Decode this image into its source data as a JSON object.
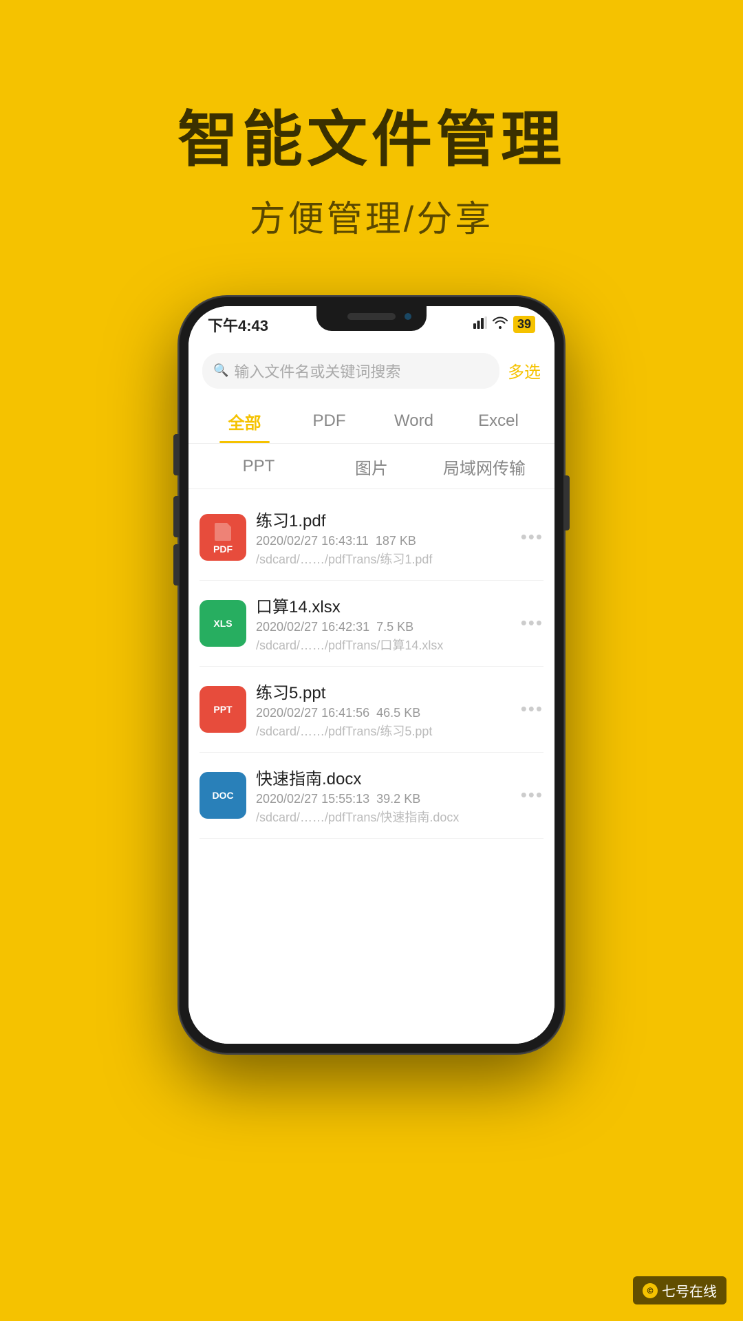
{
  "hero": {
    "title": "智能文件管理",
    "subtitle": "方便管理/分享"
  },
  "status_bar": {
    "time": "下午4:43",
    "signal": "📶",
    "wifi": "WiFi",
    "battery": "39"
  },
  "search": {
    "placeholder": "输入文件名或关键词搜索",
    "multiselect": "多选"
  },
  "tabs_row1": [
    {
      "id": "all",
      "label": "全部",
      "active": true
    },
    {
      "id": "pdf",
      "label": "PDF",
      "active": false
    },
    {
      "id": "word",
      "label": "Word",
      "active": false
    },
    {
      "id": "excel",
      "label": "Excel",
      "active": false
    }
  ],
  "tabs_row2": [
    {
      "id": "ppt",
      "label": "PPT",
      "active": false
    },
    {
      "id": "image",
      "label": "图片",
      "active": false
    },
    {
      "id": "lan",
      "label": "局域网传输",
      "active": false
    }
  ],
  "files": [
    {
      "name": "练习1.pdf",
      "type": "pdf",
      "type_label": "PDF",
      "date": "2020/02/27 16:43:11",
      "size": "187 KB",
      "path": "/sdcard/……/pdfTrans/练习1.pdf"
    },
    {
      "name": "口算14.xlsx",
      "type": "xlsx",
      "type_label": "XLS",
      "date": "2020/02/27 16:42:31",
      "size": "7.5 KB",
      "path": "/sdcard/……/pdfTrans/口算14.xlsx"
    },
    {
      "name": "练习5.ppt",
      "type": "ppt",
      "type_label": "PPT",
      "date": "2020/02/27 16:41:56",
      "size": "46.5 KB",
      "path": "/sdcard/……/pdfTrans/练习5.ppt"
    },
    {
      "name": "快速指南.docx",
      "type": "docx",
      "type_label": "DOC",
      "date": "2020/02/27 15:55:13",
      "size": "39.2 KB",
      "path": "/sdcard/……/pdfTrans/快速指南.docx"
    }
  ],
  "watermark": {
    "icon": "©",
    "text": "七号在线"
  }
}
